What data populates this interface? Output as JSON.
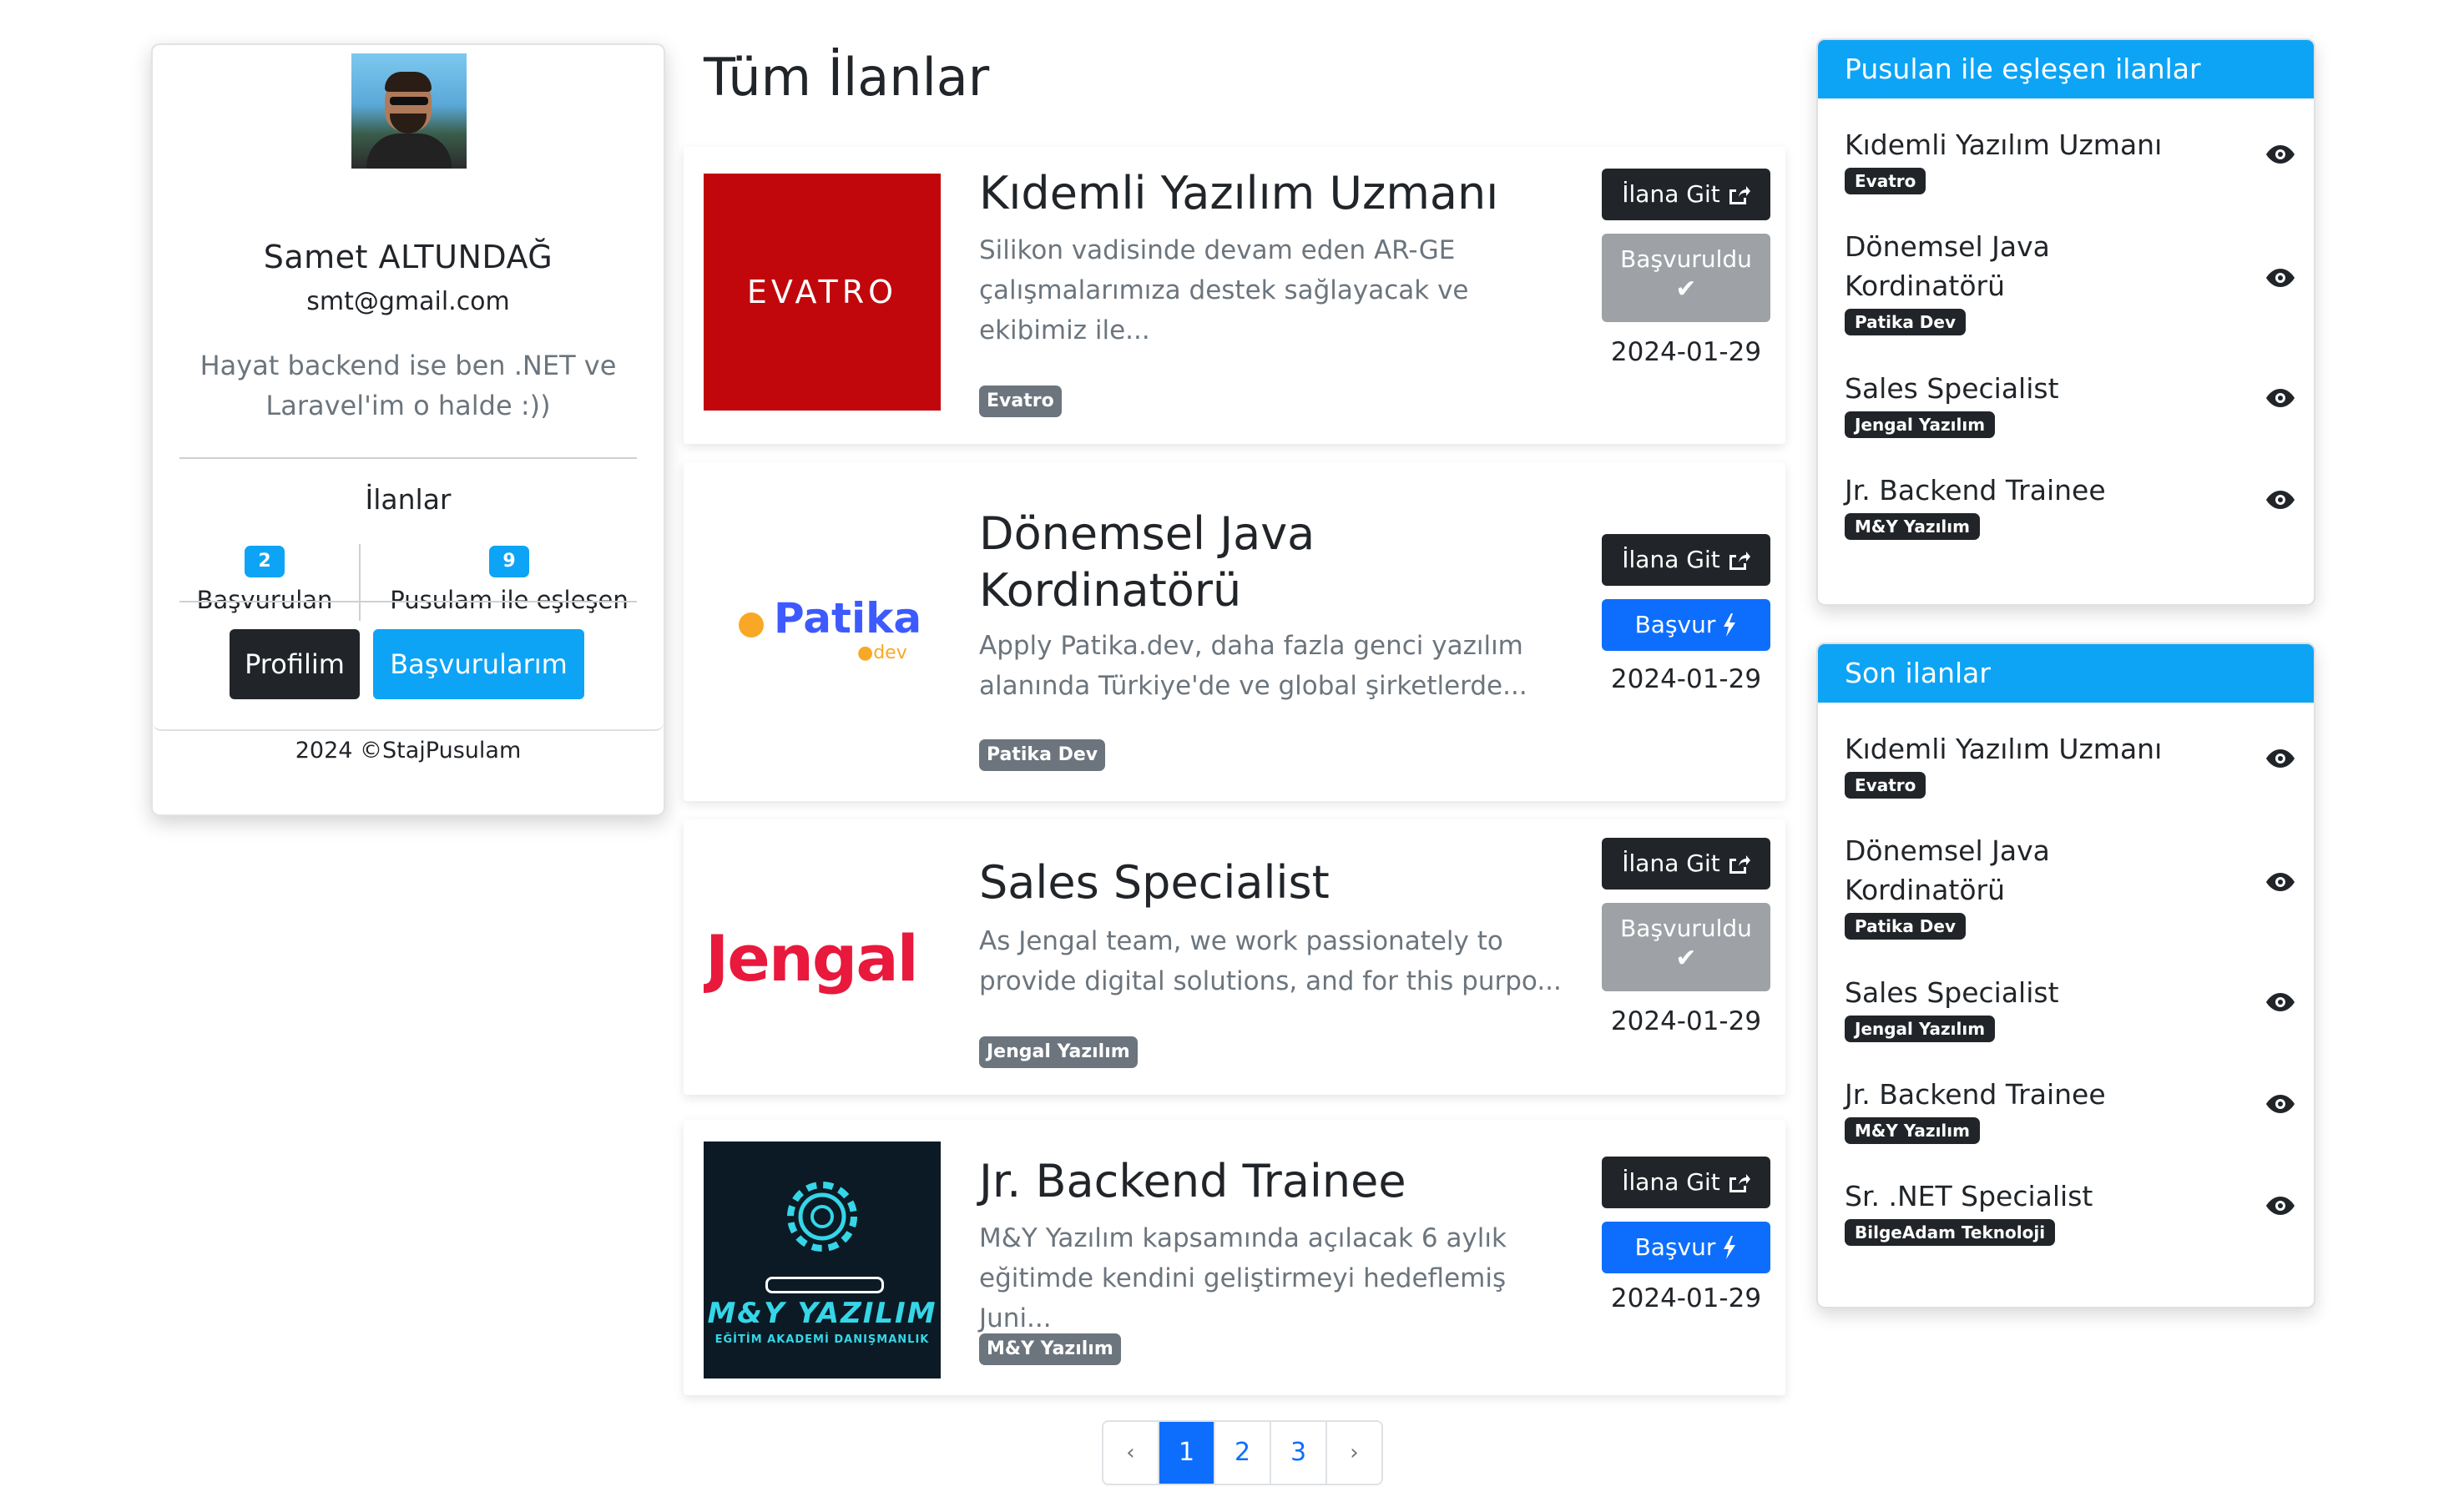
{
  "profile": {
    "name": "Samet ALTUNDAĞ",
    "email": "smt@gmail.com",
    "bio": "Hayat backend ise ben .NET ve Laravel'im o halde :))",
    "section_title": "İlanlar",
    "stats": [
      {
        "count": "2",
        "label": "Başvurulan"
      },
      {
        "count": "9",
        "label": "Pusulam ile eşleşen"
      }
    ],
    "profile_button": "Profilim",
    "applications_button": "Başvurularım",
    "footer": "2024 ©StajPusulam"
  },
  "main": {
    "title": "Tüm İlanlar",
    "go_label": "İlana Git",
    "apply_label": "Başvur",
    "applied_label": "Başvuruldu",
    "jobs": [
      {
        "title": "Kıdemli Yazılım Uzmanı",
        "description": "Silikon vadisinde devam eden AR-GE çalışmalarımıza destek sağlayacak ve ekibimiz ile...",
        "company": "Evatro",
        "date": "2024-01-29",
        "status": "applied",
        "logo_text": "EVATRO"
      },
      {
        "title": "Dönemsel Java Kordinatörü",
        "description": "Apply Patika.dev, daha fazla genci yazılım alanında Türkiye'de ve global şirketlerde...",
        "company": "Patika Dev",
        "date": "2024-01-29",
        "status": "open",
        "logo_text": "Patika",
        "logo_sub": "dev"
      },
      {
        "title": "Sales Specialist",
        "description": "As Jengal team, we work passionately to provide digital solutions, and for this purpo...",
        "company": "Jengal Yazılım",
        "date": "2024-01-29",
        "status": "applied",
        "logo_text": "Jengal"
      },
      {
        "title": "Jr. Backend Trainee",
        "description": "M&Y Yazılım kapsamında açılacak 6 aylık eğitimde kendini geliştirmeyi hedeflemiş Juni...",
        "company": "M&Y Yazılım",
        "date": "2024-01-29",
        "status": "open",
        "logo_text": "M&Y YAZILIM",
        "logo_sub": "EĞİTİM AKADEMİ DANIŞMANLIK"
      }
    ]
  },
  "pagination": {
    "prev": "‹",
    "pages": [
      "1",
      "2",
      "3"
    ],
    "active": "1",
    "next": "›"
  },
  "matched": {
    "title": "Pusulan ile eşleşen ilanlar",
    "items": [
      {
        "title": "Kıdemli Yazılım Uzmanı",
        "company": "Evatro"
      },
      {
        "title": "Dönemsel Java Kordinatörü",
        "company": "Patika Dev"
      },
      {
        "title": "Sales Specialist",
        "company": "Jengal Yazılım"
      },
      {
        "title": "Jr. Backend Trainee",
        "company": "M&Y Yazılım"
      }
    ]
  },
  "recent": {
    "title": "Son ilanlar",
    "items": [
      {
        "title": "Kıdemli Yazılım Uzmanı",
        "company": "Evatro"
      },
      {
        "title": "Dönemsel Java Kordinatörü",
        "company": "Patika Dev"
      },
      {
        "title": "Sales Specialist",
        "company": "Jengal Yazılım"
      },
      {
        "title": "Jr. Backend Trainee",
        "company": "M&Y Yazılım"
      },
      {
        "title": "Sr. .NET Specialist",
        "company": "BilgeAdam Teknoloji"
      }
    ]
  },
  "colors": {
    "accent": "#0da4f6",
    "primary": "#0d6efd",
    "dark": "#212529",
    "muted": "#6c757d",
    "evatro_red": "#c1070b",
    "jengal_red": "#e8193c",
    "patika_blue": "#3d5afe",
    "patika_orange": "#f9a825",
    "my_cyan": "#35d6e8"
  },
  "icons": {
    "go": "external-link-icon",
    "apply": "bolt-icon",
    "applied": "check-icon",
    "view": "eye-icon"
  }
}
